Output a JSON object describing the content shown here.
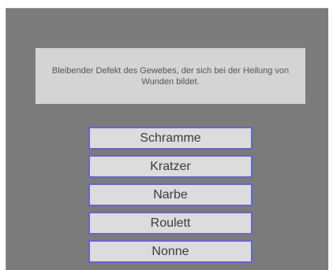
{
  "question": {
    "text": "Bleibender Defekt des Gewebes, der sich bei der Heilung von Wunden bildet."
  },
  "answers": [
    {
      "label": "Schramme"
    },
    {
      "label": "Kratzer"
    },
    {
      "label": "Narbe"
    },
    {
      "label": "Roulett"
    },
    {
      "label": "Nonne"
    }
  ],
  "colors": {
    "panel": "#7b7b7b",
    "question_box": "#d4d4d4",
    "answer_fill": "#dcdcdc",
    "answer_border": "#6a62cc"
  }
}
